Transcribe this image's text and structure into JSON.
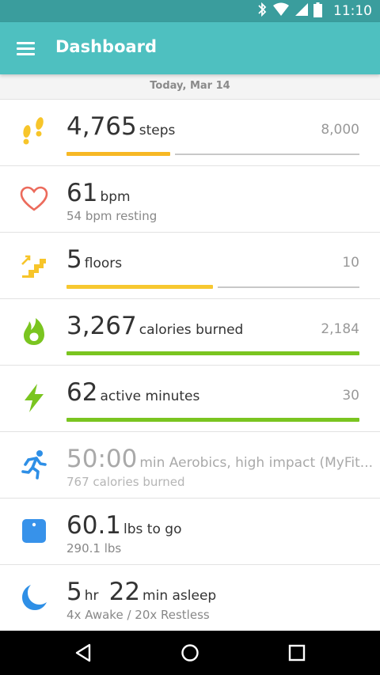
{
  "status_bar": {
    "time": "11:10",
    "icons": [
      "bluetooth-icon",
      "wifi-icon",
      "signal-icon",
      "battery-icon"
    ]
  },
  "app_bar": {
    "title": "Dashboard",
    "menu_icon": "hamburger-menu-icon"
  },
  "date_label": "Today, Mar 14",
  "colors": {
    "status_bar": "#3a9d9d",
    "app_bar": "#4ec0c0",
    "steps_bar": "#f7b824",
    "floors_bar": "#f7c830",
    "green_bar": "#7ac520",
    "heart": "#ec6b5c",
    "runner": "#2e8fe6",
    "scale": "#3792ea",
    "moon": "#2e8fe6"
  },
  "tiles": {
    "steps": {
      "value": "4,765",
      "unit": "steps",
      "goal": "8,000",
      "progress": 0.596,
      "icon": "footprints-icon"
    },
    "heart": {
      "value": "61",
      "unit": "bpm",
      "sub": "54 bpm resting",
      "icon": "heart-icon"
    },
    "floors": {
      "value": "5",
      "unit": "floors",
      "goal": "10",
      "progress": 0.5,
      "icon": "stairs-icon"
    },
    "calories": {
      "value": "3,267",
      "unit": "calories burned",
      "goal": "2,184",
      "progress": 1.0,
      "icon": "flame-icon"
    },
    "active": {
      "value": "62",
      "unit": "active minutes",
      "goal": "30",
      "progress": 1.0,
      "icon": "lightning-icon"
    },
    "exercise": {
      "value": "50:00",
      "unit": "min Aerobics, high impact (MyFit...",
      "sub": "767 calories burned",
      "icon": "runner-icon"
    },
    "weight": {
      "value": "60.1",
      "unit": "lbs to go",
      "sub": "290.1 lbs",
      "icon": "scale-icon"
    },
    "sleep": {
      "hours": "5",
      "hours_unit": "hr",
      "minutes": "22",
      "minutes_unit": "min asleep",
      "sub": "4x Awake / 20x Restless",
      "icon": "moon-icon"
    }
  },
  "nav_bar": [
    "back-icon",
    "home-icon",
    "recents-icon"
  ]
}
